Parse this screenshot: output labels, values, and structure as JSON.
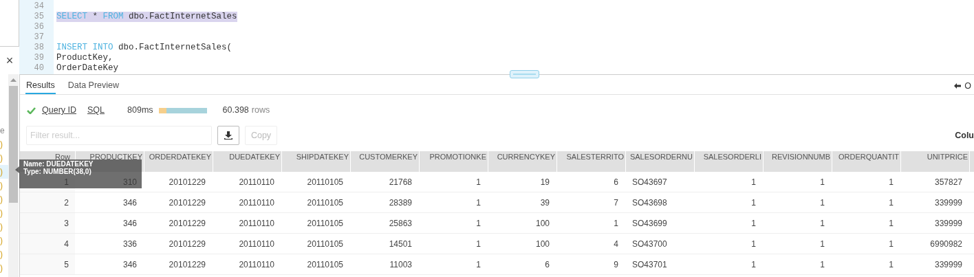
{
  "side_panel": {
    "close": "×",
    "fragments": [
      {
        "text": "e",
        "kind": "label",
        "selected": false
      },
      {
        "text": ")",
        "kind": "count",
        "selected": false
      },
      {
        "text": ")",
        "kind": "count",
        "selected": false
      },
      {
        "text": ")",
        "kind": "count",
        "selected": true
      },
      {
        "text": ")",
        "kind": "count",
        "selected": false
      },
      {
        "text": ")",
        "kind": "count",
        "selected": false
      },
      {
        "text": ")",
        "kind": "count",
        "selected": false
      },
      {
        "text": ")",
        "kind": "count",
        "selected": false
      },
      {
        "text": ")",
        "kind": "count",
        "selected": false
      },
      {
        "text": ")",
        "kind": "count",
        "selected": false
      },
      {
        "text": ")",
        "kind": "count",
        "selected": false
      }
    ]
  },
  "editor": {
    "lines": [
      {
        "number": "34",
        "highlighted": false
      },
      {
        "number": "35",
        "highlighted": true,
        "segments": [
          {
            "kind": "keyword",
            "text": "SELECT"
          },
          {
            "kind": "text",
            "text": "*"
          },
          {
            "kind": "keyword",
            "text": "FROM"
          },
          {
            "kind": "text",
            "text": "dbo.FactInternetSales"
          }
        ]
      },
      {
        "number": "36",
        "highlighted": false
      },
      {
        "number": "37",
        "highlighted": false
      },
      {
        "number": "38",
        "highlighted": false,
        "segments": [
          {
            "kind": "keyword",
            "text": "INSERT"
          },
          {
            "kind": "keyword",
            "text": "INTO"
          },
          {
            "kind": "text",
            "text": "dbo.FactInternetSales("
          }
        ]
      },
      {
        "number": "39",
        "highlighted": false,
        "segments": [
          {
            "kind": "text",
            "text": "ProductKey,"
          }
        ]
      },
      {
        "number": "40",
        "highlighted": false,
        "segments": [
          {
            "kind": "text",
            "text": "OrderDateKey"
          }
        ]
      }
    ]
  },
  "results": {
    "tabs": [
      {
        "label": "Results",
        "selected": true
      },
      {
        "label": "Data Preview",
        "selected": false
      }
    ],
    "right_action": "O",
    "status": {
      "query_id": "Query ID",
      "sql": "SQL",
      "duration": "809ms",
      "row_count": "60.398",
      "rows_label": "rows"
    },
    "filter": {
      "placeholder": "Filter result..."
    },
    "copy_button": {
      "label": "Copy",
      "disabled": true
    },
    "columns_label": "Colu",
    "table": {
      "columns": [
        "Row",
        "PRODUCTKEY",
        "ORDERDATEKEY",
        "DUEDATEKEY",
        "SHIPDATEKEY",
        "CUSTOMERKEY",
        "PROMOTIONKE",
        "CURRENCYKEY",
        "SALESTERRITO",
        "SALESORDERNU",
        "SALESORDERLI",
        "REVISIONNUMB",
        "ORDERQUANTIT",
        "UNITPRICE"
      ],
      "rows": [
        [
          "1",
          "310",
          "20101229",
          "20110110",
          "20110105",
          "21768",
          "1",
          "19",
          "6",
          "SO43697",
          "1",
          "1",
          "1",
          "357827"
        ],
        [
          "2",
          "346",
          "20101229",
          "20110110",
          "20110105",
          "28389",
          "1",
          "39",
          "7",
          "SO43698",
          "1",
          "1",
          "1",
          "339999"
        ],
        [
          "3",
          "346",
          "20101229",
          "20110110",
          "20110105",
          "25863",
          "1",
          "100",
          "1",
          "SO43699",
          "1",
          "1",
          "1",
          "339999"
        ],
        [
          "4",
          "336",
          "20101229",
          "20110110",
          "20110105",
          "14501",
          "1",
          "100",
          "4",
          "SO43700",
          "1",
          "1",
          "1",
          "6990982"
        ],
        [
          "5",
          "346",
          "20101229",
          "20110110",
          "20110105",
          "11003",
          "1",
          "6",
          "9",
          "SO43701",
          "1",
          "1",
          "1",
          "339999"
        ]
      ]
    },
    "tooltip": {
      "lines": [
        "Name: DUEDATEKEY",
        "Type: NUMBER(38,0)"
      ]
    }
  }
}
